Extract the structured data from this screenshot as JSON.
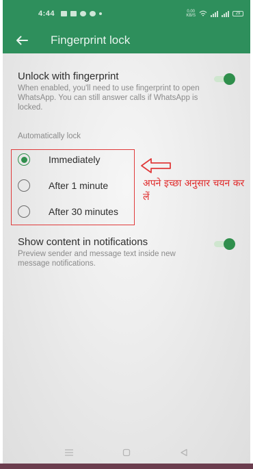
{
  "status_bar": {
    "time": "4:44",
    "net_speed_value": "0.00",
    "net_speed_unit": "KB/S",
    "battery": "29"
  },
  "app_bar": {
    "title": "Fingerprint lock",
    "back_icon": "arrow-left-icon"
  },
  "unlock_setting": {
    "title": "Unlock with fingerprint",
    "description": "When enabled, you'll need to use fingerprint to open WhatsApp. You can still answer calls if WhatsApp is locked.",
    "enabled": true
  },
  "auto_lock": {
    "section_label": "Automatically lock",
    "options": [
      {
        "label": "Immediately",
        "selected": true
      },
      {
        "label": "After 1 minute",
        "selected": false
      },
      {
        "label": "After 30 minutes",
        "selected": false
      }
    ]
  },
  "annotation": {
    "text": "अपने इच्छा अनुसार चयन कर लें",
    "color": "#e02a2a"
  },
  "notifications_setting": {
    "title": "Show content in notifications",
    "description": "Preview sender and message text inside new message notifications.",
    "enabled": true
  },
  "nav_bar": {
    "icons": [
      "menu-icon",
      "home-square-icon",
      "back-triangle-icon"
    ]
  },
  "colors": {
    "brand": "#2e8f5c",
    "accent": "#2f8f4c",
    "annotation": "#e03a3a"
  }
}
